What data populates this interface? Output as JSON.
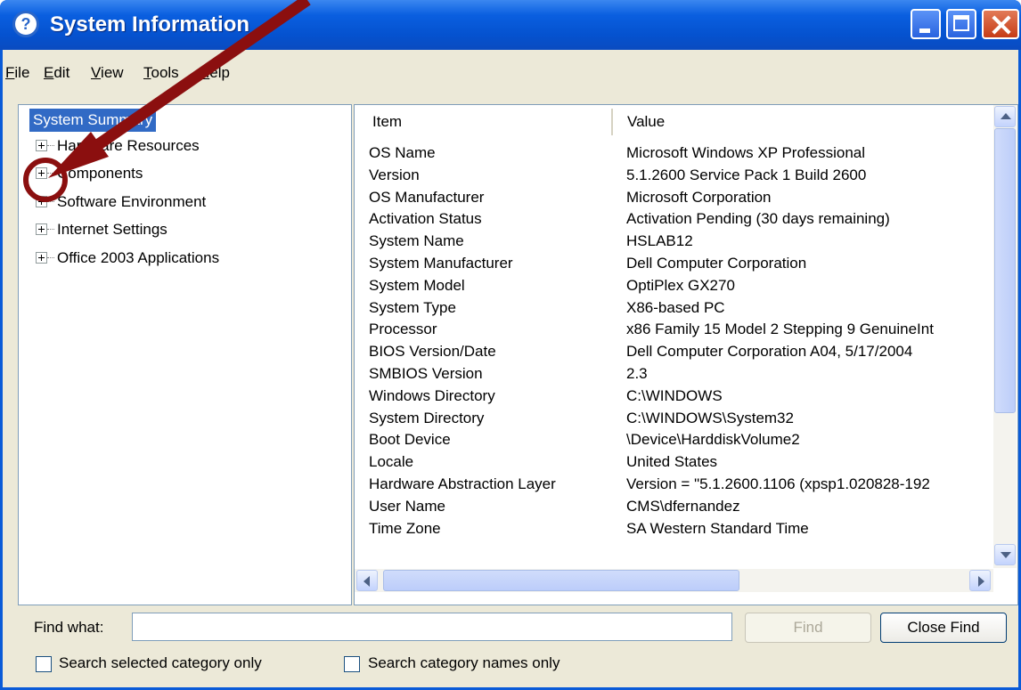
{
  "window": {
    "title": "System Information"
  },
  "menu": [
    "File",
    "Edit",
    "View",
    "Tools",
    "Help"
  ],
  "tree": {
    "selected": "System Summary",
    "items": [
      "Hardware Resources",
      "Components",
      "Software Environment",
      "Internet Settings",
      "Office 2003 Applications"
    ]
  },
  "list": {
    "columns": [
      "Item",
      "Value"
    ],
    "rows": [
      [
        "OS Name",
        "Microsoft Windows XP Professional"
      ],
      [
        "Version",
        "5.1.2600 Service Pack 1 Build 2600"
      ],
      [
        "OS Manufacturer",
        "Microsoft Corporation"
      ],
      [
        "Activation Status",
        "Activation Pending (30 days remaining)"
      ],
      [
        "System Name",
        "HSLAB12"
      ],
      [
        "System Manufacturer",
        "Dell Computer Corporation"
      ],
      [
        "System Model",
        "OptiPlex GX270"
      ],
      [
        "System Type",
        "X86-based PC"
      ],
      [
        "Processor",
        "x86 Family 15 Model 2 Stepping 9 GenuineInt"
      ],
      [
        "BIOS Version/Date",
        "Dell Computer Corporation A04, 5/17/2004"
      ],
      [
        "SMBIOS Version",
        "2.3"
      ],
      [
        "Windows Directory",
        "C:\\WINDOWS"
      ],
      [
        "System Directory",
        "C:\\WINDOWS\\System32"
      ],
      [
        "Boot Device",
        "\\Device\\HarddiskVolume2"
      ],
      [
        "Locale",
        "United States"
      ],
      [
        "Hardware Abstraction Layer",
        "Version = \"5.1.2600.1106 (xpsp1.020828-192"
      ],
      [
        "User Name",
        "CMS\\dfernandez"
      ],
      [
        "Time Zone",
        "SA Western Standard Time"
      ]
    ]
  },
  "find": {
    "label": "Find what:",
    "value": "",
    "find_button": "Find",
    "close_button": "Close Find",
    "option_selected_category": "Search selected category only",
    "option_category_names": "Search category names only"
  },
  "icons": {
    "title": "info-icon",
    "expand": "plus-box-icon"
  },
  "colors": {
    "titlebar": "#0a5fe0",
    "selection": "#316ac5",
    "annotation": "#8b0f0f"
  }
}
